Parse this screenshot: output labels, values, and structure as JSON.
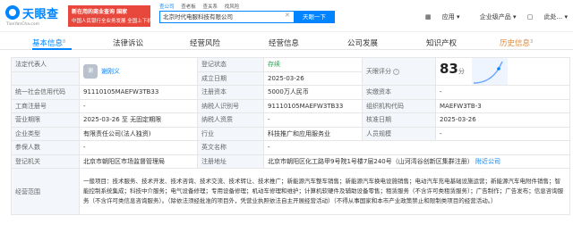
{
  "header": {
    "logo_text": "天眼查",
    "logo_sub": "TianYanCha.com",
    "banner_line1": "新在用的商业查询 国家",
    "banner_line2": "中国人民银行全业务发展 全国上下机构",
    "search_tabs": [
      "查公司",
      "查老板",
      "查关系",
      "找风险"
    ],
    "search_value": "北京时代电服科技有限公司",
    "search_button": "天眼一下",
    "nav": [
      "应用",
      "企业级产品",
      "此处..."
    ]
  },
  "tabs": {
    "basic": "基本信息",
    "basic_badge": "8",
    "lawsuit": "法律诉讼",
    "risk": "经营风险",
    "info": "经营信息",
    "dev": "公司发展",
    "ip": "知识产权",
    "history": "历史信息",
    "history_badge": "3"
  },
  "rows": {
    "rep_label": "法定代表人",
    "rep_avatar": "谢",
    "rep_name": "谢刚义",
    "status_label": "登记状态",
    "status_value": "存续",
    "founded_label": "成立日期",
    "founded_value": "2025-03-26",
    "score_label": "天眼评分",
    "score_value": "83",
    "score_unit": "分",
    "credit_label": "统一社会信用代码",
    "credit_value": "91110105MAEFW3TB33",
    "capital_label": "注册资本",
    "capital_value": "5000万人民币",
    "paid_label": "实缴资本",
    "paid_value": "-",
    "regno_label": "工商注册号",
    "regno_value": "-",
    "taxid_label": "纳税人识别号",
    "taxid_value": "91110105MAEFW3TB33",
    "org_label": "组织机构代码",
    "org_value": "MAEFW3TB-3",
    "term_label": "营业期限",
    "term_value": "2025-03-26 至 无固定期限",
    "taxq_label": "纳税人资质",
    "taxq_value": "-",
    "approve_label": "核准日期",
    "approve_value": "2025-03-26",
    "type_label": "企业类型",
    "type_value": "有限责任公司(法人独资)",
    "industry_label": "行业",
    "industry_value": "科技推广和应用服务业",
    "staff_label": "人员规模",
    "staff_value": "-",
    "insured_label": "参保人数",
    "insured_value": "-",
    "en_label": "英文名称",
    "en_value": "-",
    "authority_label": "登记机关",
    "authority_value": "北京市朝阳区市场监督管理局",
    "address_label": "注册地址",
    "address_value": "北京市朝阳区化工路甲9号院1号楼7层240号（山河湾谷创新区集群注册）",
    "address_link": "附近公司",
    "scope_label": "经营范围",
    "scope_value": "一般项目：技术服务、技术开发、技术咨询、技术交流、技术转让、技术推广；新能源汽车整车销售；新能源汽车换电设施销售；电动汽车充电基础设施运营；新能源汽车电附件销售；智能控制系统集成；科技中介服务；电气设备修理；专用设备修理；机动车修理和维护；计算机软硬件及辅助设备零售；租赁服务（不含许可类租赁服务）；广告制作；广告发布；信息咨询服务（不含许可类信息咨询服务）。（除依法须经批准的项目外，凭营业执照依法自主开展经营活动）（不得从事国家和本市产业政策禁止和限制类项目的经营活动。）"
  },
  "colors": {
    "accent": "#0084ff",
    "status_green": "#2aa052",
    "label_bg": "#f3f6fb"
  }
}
